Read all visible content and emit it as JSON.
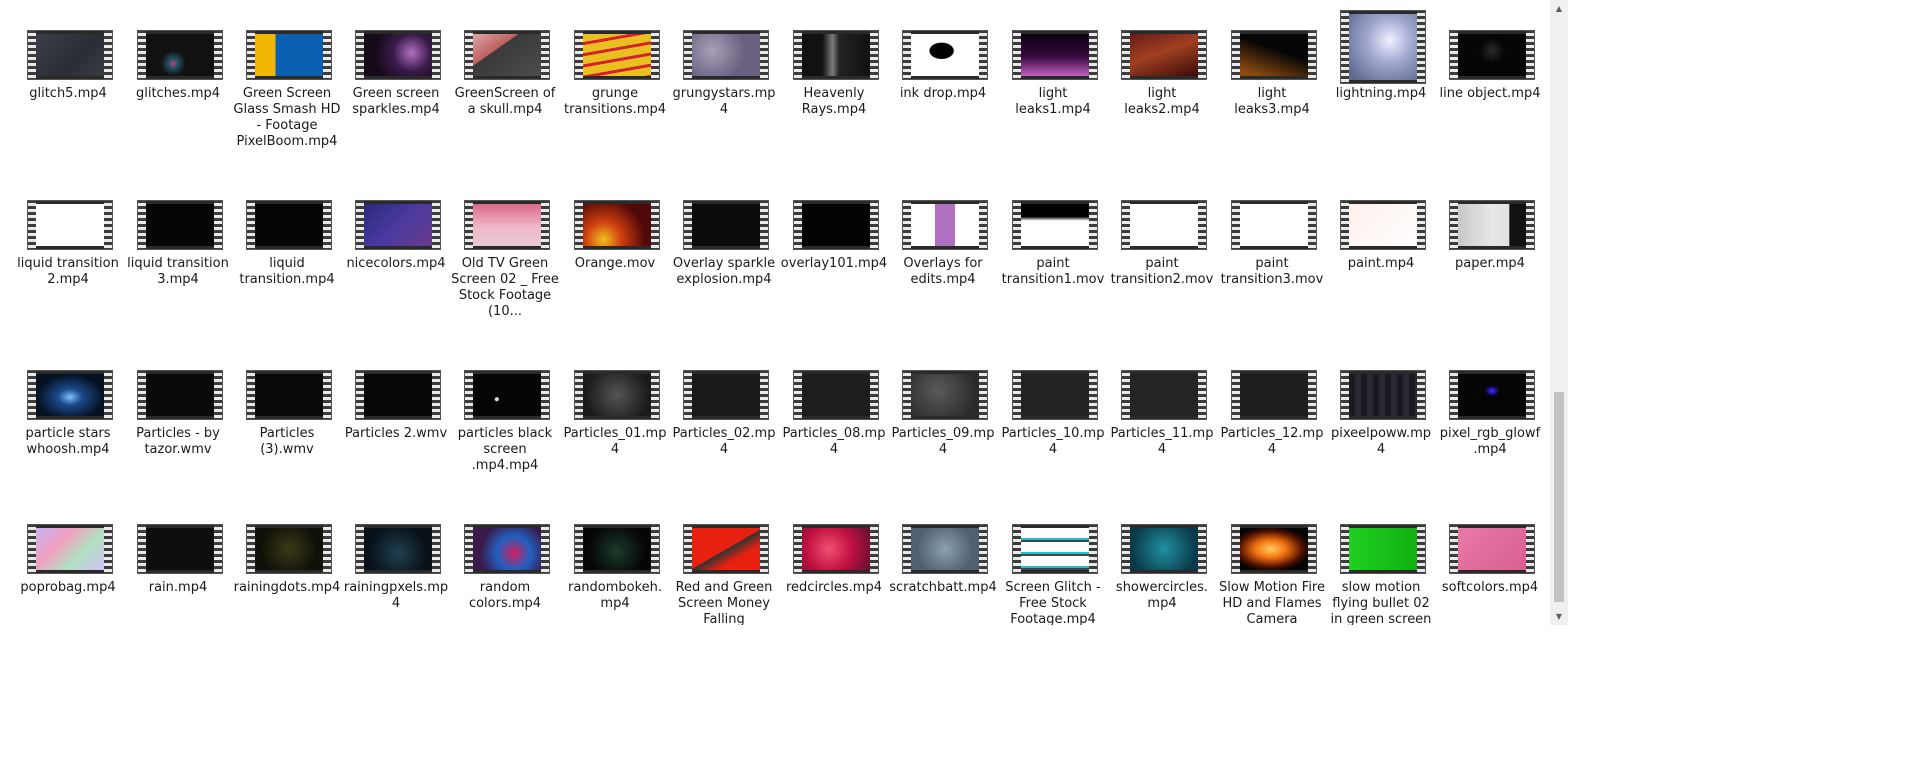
{
  "files": [
    {
      "name": "glitch5.mp4",
      "bg": "linear-gradient(135deg,#3c3f48,#2b2d35 60%,#3a3c44)"
    },
    {
      "name": "glitches.mp4",
      "bg": "radial-gradient(circle at 40% 70%,#c04080 0,#205060 10%,#111 25%),#111"
    },
    {
      "name": "Green Screen Glass Smash HD - Footage PixelBoom.mp4",
      "bg": "linear-gradient(90deg,#f2b705 0,#f2b705 30%,#0b5fb0 30%,#0b5fb0 100%)"
    },
    {
      "name": "Green screen sparkles.mp4",
      "bg": "radial-gradient(circle at 70% 45%,#b070c0,#3a1a4a 35%,#150a18 70%)"
    },
    {
      "name": "GreenScreen of a skull.mp4",
      "bg": "linear-gradient(145deg,#d8a8a8 0,#c06060 35%,#3a3a3a 36%,#4c4c4c 100%)"
    },
    {
      "name": "grunge transitions.mp4",
      "bg": "repeating-linear-gradient(170deg,#e8c020 0,#e8c020 8px,#d82030 8px,#d82030 11px)"
    },
    {
      "name": "grungystars.mp4",
      "bg": "radial-gradient(circle at 30% 40%,#a8a0b8,#6a6080 60%)"
    },
    {
      "name": "Heavenly Rays.mp4",
      "bg": "linear-gradient(90deg,#111 30%,#7a7a7a 45%,#222 55%,#111)"
    },
    {
      "name": "ink drop.mp4",
      "bg": "radial-gradient(ellipse at 45% 40%,#000 0,#000 22%,#fff 24%)"
    },
    {
      "name": "light leaks1.mp4",
      "bg": "linear-gradient(180deg,#0a0010 0,#3a0a40 55%,#c060c0 100%)"
    },
    {
      "name": "light leaks2.mp4",
      "bg": "linear-gradient(160deg,#6a1a1a,#a04020 45%,#3a0a0a)"
    },
    {
      "name": "light leaks3.mp4",
      "bg": "linear-gradient(200deg,#050505 40%,#8a4a10 90%)"
    },
    {
      "name": "lightning.mp4",
      "bg": "radial-gradient(circle at 60% 40%,#f0f0ff,#a0a8d0 40%,#606890 90%)",
      "tall": true
    },
    {
      "name": "line object.mp4",
      "bg": "radial-gradient(circle at 50% 40%,#2a2a2a,#050505 30%)"
    },
    {
      "name": "liquid transition 2.mp4",
      "bg": "#ffffff"
    },
    {
      "name": "liquid transition 3.mp4",
      "bg": "#050505"
    },
    {
      "name": "liquid transition.mp4",
      "bg": "#050505"
    },
    {
      "name": "nicecolors.mp4",
      "bg": "linear-gradient(135deg,#2a2a7a,#4a3aa0 50%,#6a3a8a)"
    },
    {
      "name": "Old TV Green Screen 02 _ Free Stock Footage (10...",
      "bg": "linear-gradient(180deg,#d86a8a 0,#f0b8c8 55%,#e8c8d0 100%)"
    },
    {
      "name": "Orange.mov",
      "bg": "radial-gradient(circle at 30% 85%,#f0c020,#d04010 30%,#500808 70%)"
    },
    {
      "name": "Overlay sparkle explosion.mp4",
      "bg": "#0c0c0c"
    },
    {
      "name": "overlay101.mp4",
      "bg": "#030303"
    },
    {
      "name": "Overlays for edits.mp4",
      "bg": "linear-gradient(90deg,#fff 0,#fff 35%,#b070c0 35%,#b070c0 65%,#fff 65%)"
    },
    {
      "name": "paint transition1.mov",
      "bg": "linear-gradient(180deg,#000 0,#000 30%,#fff 40%)"
    },
    {
      "name": "paint transition2.mov",
      "bg": "#ffffff"
    },
    {
      "name": "paint transition3.mov",
      "bg": "#ffffff"
    },
    {
      "name": "paint.mp4",
      "bg": "linear-gradient(135deg,#fdf0ec,#ffffff)"
    },
    {
      "name": "paper.mp4",
      "bg": "linear-gradient(90deg,#c8c8c8 0,#e8e8e8 50%,#e0e0e0 75%,#111 76%)"
    },
    {
      "name": "particle stars whoosh.mp4",
      "bg": "radial-gradient(ellipse at 50% 55%,#80c0ff 0,#1a4a8a 25%,#051020 70%)"
    },
    {
      "name": "Particles - by tazor.wmv",
      "bg": "#0a0a0a"
    },
    {
      "name": "Particles (3).wmv",
      "bg": "#080808"
    },
    {
      "name": "Particles 2.wmv",
      "bg": "#060606"
    },
    {
      "name": "particles black screen .mp4.mp4",
      "bg": "radial-gradient(circle at 35% 60%,#ddd 0,#ddd 3%,#050505 5%)"
    },
    {
      "name": "Particles_01.mp4",
      "bg": "radial-gradient(circle at 50% 50%,#555,#1a1a1a 80%)"
    },
    {
      "name": "Particles_02.mp4",
      "bg": "#1a1a1a"
    },
    {
      "name": "Particles_08.mp4",
      "bg": "#1e1e1e"
    },
    {
      "name": "Particles_09.mp4",
      "bg": "radial-gradient(circle at 40% 40%,#5a5a5a,#2a2a2a 80%)"
    },
    {
      "name": "Particles_10.mp4",
      "bg": "#222222"
    },
    {
      "name": "Particles_11.mp4",
      "bg": "#242424"
    },
    {
      "name": "Particles_12.mp4",
      "bg": "#1e1e1e"
    },
    {
      "name": "pixeelpoww.mp4",
      "bg": "repeating-linear-gradient(90deg,#1a1a20 0,#1a1a20 6px,#2a2a34 6px,#2a2a34 12px)"
    },
    {
      "name": "pixel_rgb_glowf .mp4",
      "bg": "radial-gradient(ellipse at 50% 40%,#4a30ff 0,#2010a0 8%,#050505 15%)"
    },
    {
      "name": "poprobag.mp4",
      "bg": "linear-gradient(135deg,#c8b0f0,#f0a0c0 35%,#b0e0c0 65%,#d0c0f8)"
    },
    {
      "name": "rain.mp4",
      "bg": "#0e0e0e"
    },
    {
      "name": "rainingdots.mp4",
      "bg": "radial-gradient(circle at 50% 50%,#3a3a18,#101008 70%)"
    },
    {
      "name": "rainingpxels.mp4",
      "bg": "radial-gradient(circle at 50% 60%,#204050,#081018 70%)"
    },
    {
      "name": "random colors.mp4",
      "bg": "radial-gradient(circle at 60% 60%,#d02060,#2060c0 35%,#3a1a4a 70%)"
    },
    {
      "name": "randombokeh. mp4",
      "bg": "radial-gradient(circle at 50% 55%,#1a3a2a,#050505 70%)"
    },
    {
      "name": "Red and Green Screen Money Falling",
      "bg": "linear-gradient(150deg,#e82010 0,#e82010 50%,#333 51%,#e82010 70%)"
    },
    {
      "name": "redcircles.mp4",
      "bg": "radial-gradient(circle at 40% 50%,#f05070,#c01040 50%,#601030)"
    },
    {
      "name": "scratchbatt.mp4",
      "bg": "radial-gradient(circle at 50% 50%,#8aa0b0,#506070 70%)"
    },
    {
      "name": "Screen Glitch - Free Stock Footage.mp4",
      "bg": "repeating-linear-gradient(180deg,#ffffff 0,#ffffff 10px,#20c0d0 10px,#20c0d0 12px,#444 12px,#444 14px)"
    },
    {
      "name": "showercircles. mp4",
      "bg": "radial-gradient(circle at 50% 50%,#2090a0,#0a3a4a 80%)"
    },
    {
      "name": "Slow Motion Fire HD and Flames Camera",
      "bg": "radial-gradient(ellipse at 45% 50%,#ffd060 0,#f07010 30%,#501000 60%,#050505 75%)"
    },
    {
      "name": "slow motion flying bullet 02 in green screen",
      "bg": "linear-gradient(90deg,#20d020,#10b010)"
    },
    {
      "name": "softcolors.mp4",
      "bg": "linear-gradient(135deg,#e87aa8,#d86090)"
    }
  ],
  "scrollbar": {
    "up_icon": "▲",
    "down_icon": "▼"
  }
}
